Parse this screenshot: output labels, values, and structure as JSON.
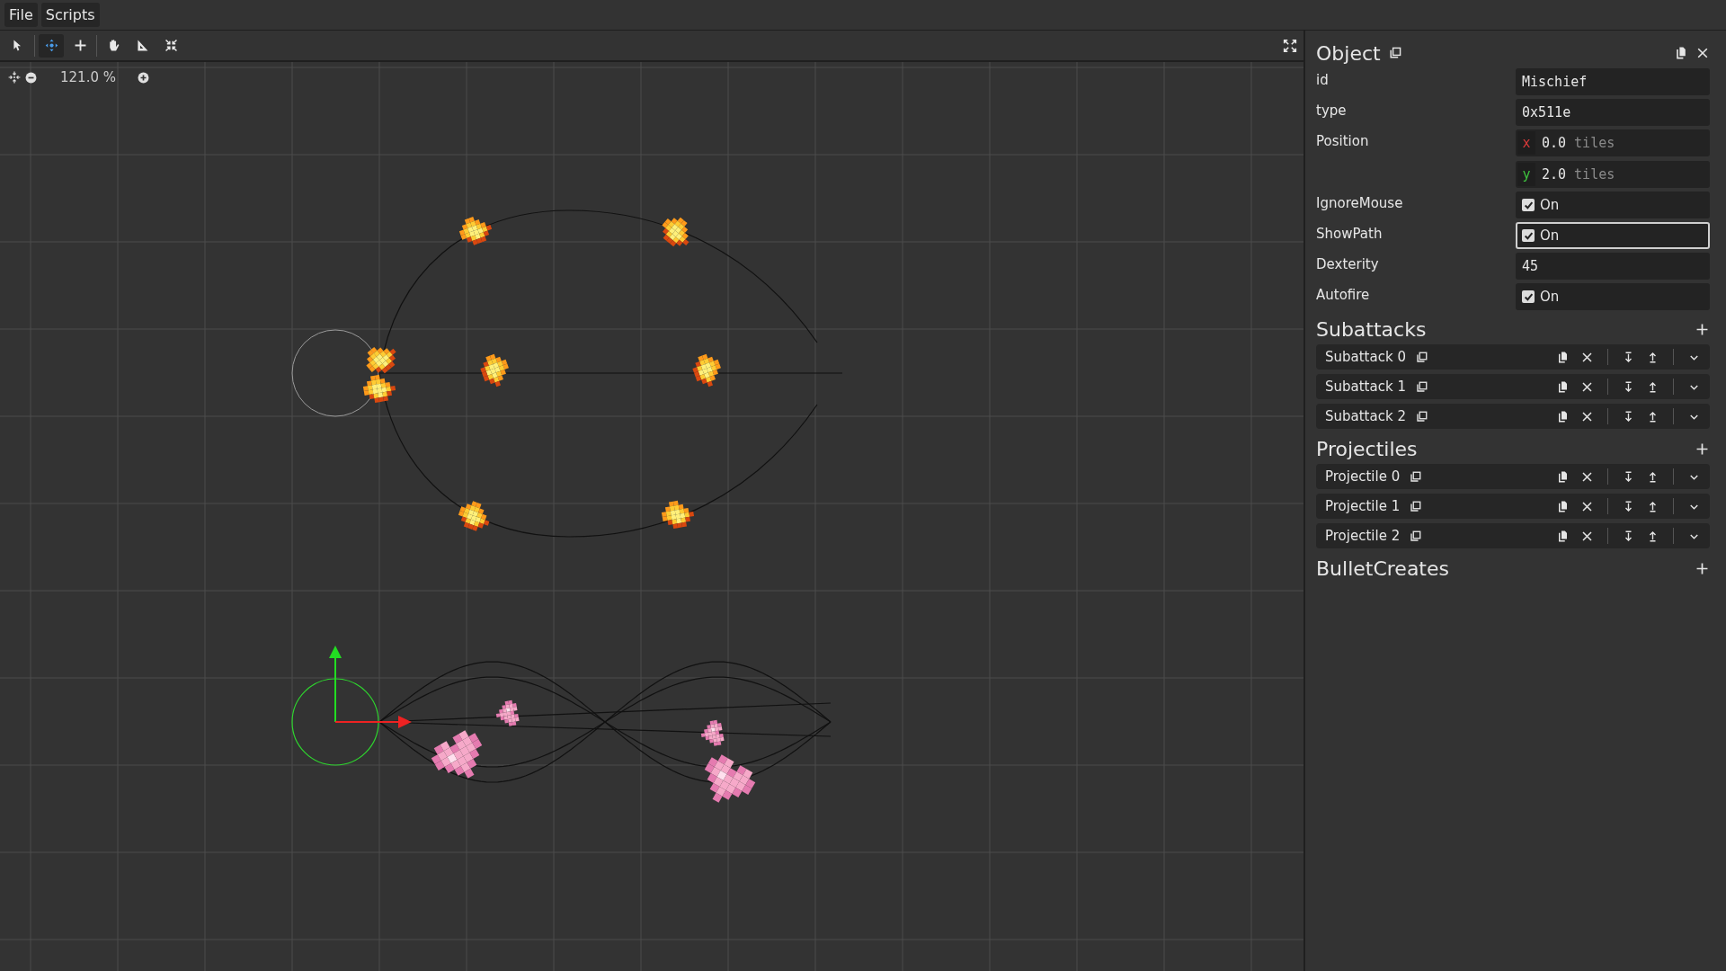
{
  "menu": [
    {
      "label": "File"
    },
    {
      "label": "Scripts"
    }
  ],
  "toolbar": {
    "tools": [
      {
        "kind": "pointer",
        "selected": false
      },
      {
        "kind": "move",
        "selected": true
      },
      {
        "kind": "add",
        "selected": false
      },
      {
        "kind": "pan",
        "selected": false
      },
      {
        "kind": "measure",
        "selected": false
      },
      {
        "kind": "collapse",
        "selected": false
      }
    ]
  },
  "zoom": {
    "reading": "121.0 %"
  },
  "properties": {
    "title": "Object",
    "fields": [
      {
        "label": "id",
        "kind": "text",
        "value": "Mischief"
      },
      {
        "label": "type",
        "kind": "text",
        "value": "0x511e"
      },
      {
        "label": "Position",
        "kind": "vector",
        "components": [
          {
            "axis": "x",
            "value": "0.0",
            "unit": "tiles",
            "color": "#d83a3a"
          },
          {
            "axis": "y",
            "value": "2.0",
            "unit": "tiles",
            "color": "#3ec23e"
          }
        ]
      },
      {
        "label": "IgnoreMouse",
        "kind": "checkbox",
        "checked": true,
        "text": "On",
        "focused": false
      },
      {
        "label": "ShowPath",
        "kind": "checkbox",
        "checked": true,
        "text": "On",
        "focused": true
      },
      {
        "label": "Dexterity",
        "kind": "text",
        "value": "45"
      },
      {
        "label": "Autofire",
        "kind": "checkbox",
        "checked": true,
        "text": "On",
        "focused": false
      }
    ]
  },
  "sections": [
    {
      "title": "Subattacks",
      "items": [
        {
          "label": "Subattack 0"
        },
        {
          "label": "Subattack 1"
        },
        {
          "label": "Subattack 2"
        }
      ]
    },
    {
      "title": "Projectiles",
      "items": [
        {
          "label": "Projectile 0"
        },
        {
          "label": "Projectile 1"
        },
        {
          "label": "Projectile 2"
        }
      ]
    },
    {
      "title": "BulletCreates"
    }
  ]
}
